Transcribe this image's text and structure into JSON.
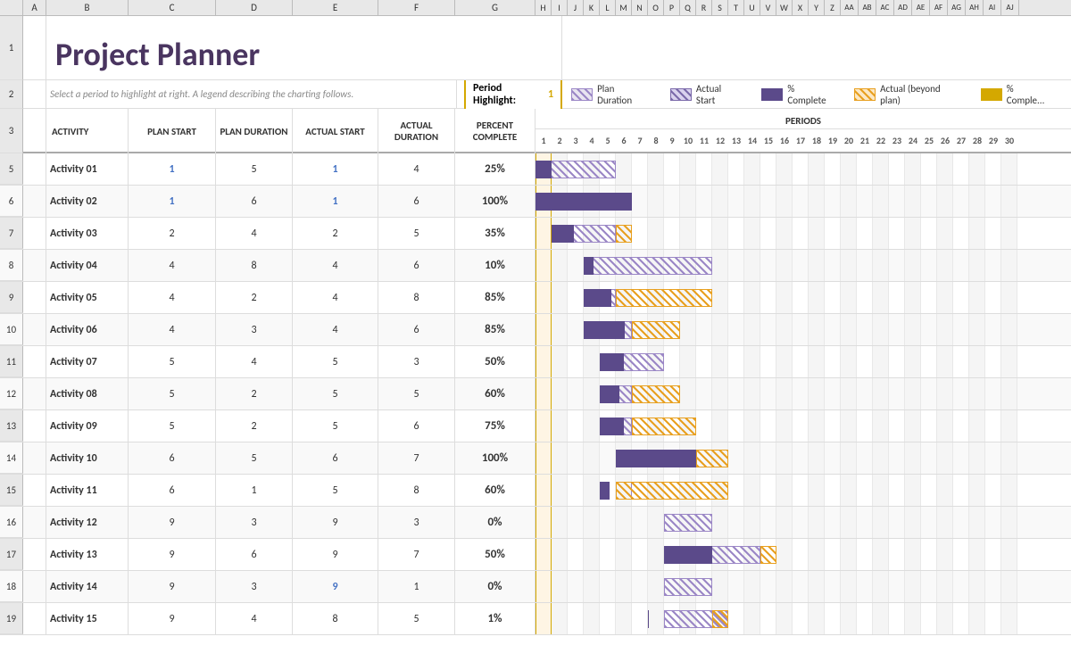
{
  "title": "Project Planner",
  "subtitle": "Select a period to highlight at right.  A legend describing the charting follows.",
  "period_highlight_label": "Period Highlight:",
  "period_highlight_value": "1",
  "legend": [
    {
      "label": "Plan Duration",
      "type": "plan"
    },
    {
      "label": "Actual Start",
      "type": "actual-start"
    },
    {
      "label": "% Complete",
      "type": "pct-complete"
    },
    {
      "label": "Actual (beyond plan)",
      "type": "beyond-plan"
    },
    {
      "label": "% Comple...",
      "type": "pct-complete2"
    }
  ],
  "columns": {
    "activity": "ACTIVITY",
    "plan_start": "PLAN START",
    "plan_duration": "PLAN DURATION",
    "actual_start": "ACTUAL START",
    "actual_duration": "ACTUAL DURATION",
    "percent_complete": "PERCENT COMPLETE",
    "periods": "PERIODS"
  },
  "period_numbers": [
    1,
    2,
    3,
    4,
    5,
    6,
    7,
    8,
    9,
    10,
    11,
    12,
    13,
    14,
    "15 16",
    17,
    18,
    19,
    20,
    21,
    22,
    23,
    24,
    25,
    26,
    27,
    28,
    29,
    30
  ],
  "activities": [
    {
      "name": "Activity 01",
      "plan_start": 1,
      "plan_duration": 5,
      "actual_start": 1,
      "actual_duration": 4,
      "percent_complete": "25%",
      "plan_start_blue": true,
      "actual_start_blue": true
    },
    {
      "name": "Activity 02",
      "plan_start": 1,
      "plan_duration": 6,
      "actual_start": 1,
      "actual_duration": 6,
      "percent_complete": "100%",
      "plan_start_blue": true,
      "actual_start_blue": true
    },
    {
      "name": "Activity 03",
      "plan_start": 2,
      "plan_duration": 4,
      "actual_start": 2,
      "actual_duration": 5,
      "percent_complete": "35%",
      "plan_start_blue": false,
      "actual_start_blue": false
    },
    {
      "name": "Activity 04",
      "plan_start": 4,
      "plan_duration": 8,
      "actual_start": 4,
      "actual_duration": 6,
      "percent_complete": "10%",
      "plan_start_blue": false,
      "actual_start_blue": false
    },
    {
      "name": "Activity 05",
      "plan_start": 4,
      "plan_duration": 2,
      "actual_start": 4,
      "actual_duration": 8,
      "percent_complete": "85%",
      "plan_start_blue": false,
      "actual_start_blue": false
    },
    {
      "name": "Activity 06",
      "plan_start": 4,
      "plan_duration": 3,
      "actual_start": 4,
      "actual_duration": 6,
      "percent_complete": "85%",
      "plan_start_blue": false,
      "actual_start_blue": false
    },
    {
      "name": "Activity 07",
      "plan_start": 5,
      "plan_duration": 4,
      "actual_start": 5,
      "actual_duration": 3,
      "percent_complete": "50%",
      "plan_start_blue": false,
      "actual_start_blue": false
    },
    {
      "name": "Activity 08",
      "plan_start": 5,
      "plan_duration": 2,
      "actual_start": 5,
      "actual_duration": 5,
      "percent_complete": "60%",
      "plan_start_blue": false,
      "actual_start_blue": false
    },
    {
      "name": "Activity 09",
      "plan_start": 5,
      "plan_duration": 2,
      "actual_start": 5,
      "actual_duration": 6,
      "percent_complete": "75%",
      "plan_start_blue": false,
      "actual_start_blue": false
    },
    {
      "name": "Activity 10",
      "plan_start": 6,
      "plan_duration": 5,
      "actual_start": 6,
      "actual_duration": 7,
      "percent_complete": "100%",
      "plan_start_blue": false,
      "actual_start_blue": false
    },
    {
      "name": "Activity 11",
      "plan_start": 6,
      "plan_duration": 1,
      "actual_start": 5,
      "actual_duration": 8,
      "percent_complete": "60%",
      "plan_start_blue": false,
      "actual_start_blue": false
    },
    {
      "name": "Activity 12",
      "plan_start": 9,
      "plan_duration": 3,
      "actual_start": 9,
      "actual_duration": 3,
      "percent_complete": "0%",
      "plan_start_blue": false,
      "actual_start_blue": false
    },
    {
      "name": "Activity 13",
      "plan_start": 9,
      "plan_duration": 6,
      "actual_start": 9,
      "actual_duration": 7,
      "percent_complete": "50%",
      "plan_start_blue": false,
      "actual_start_blue": false
    },
    {
      "name": "Activity 14",
      "plan_start": 9,
      "plan_duration": 3,
      "actual_start": 9,
      "actual_duration": 1,
      "percent_complete": "0%",
      "plan_start_blue": false,
      "actual_start_blue": true
    },
    {
      "name": "Activity 15",
      "plan_start": 9,
      "plan_duration": 4,
      "actual_start": 8,
      "actual_duration": 5,
      "percent_complete": "1%",
      "plan_start_blue": false,
      "actual_start_blue": false
    }
  ],
  "colors": {
    "title": "#4a3560",
    "plan_bar": "#9b87c6",
    "actual_bar": "#5b4a8a",
    "beyond_bar": "#e8a020",
    "pct_bar": "#d4a800",
    "highlight": "#fef5e4",
    "highlight_border": "#d4a800",
    "header_bg": "#fff",
    "blue_link": "#4472c4"
  }
}
